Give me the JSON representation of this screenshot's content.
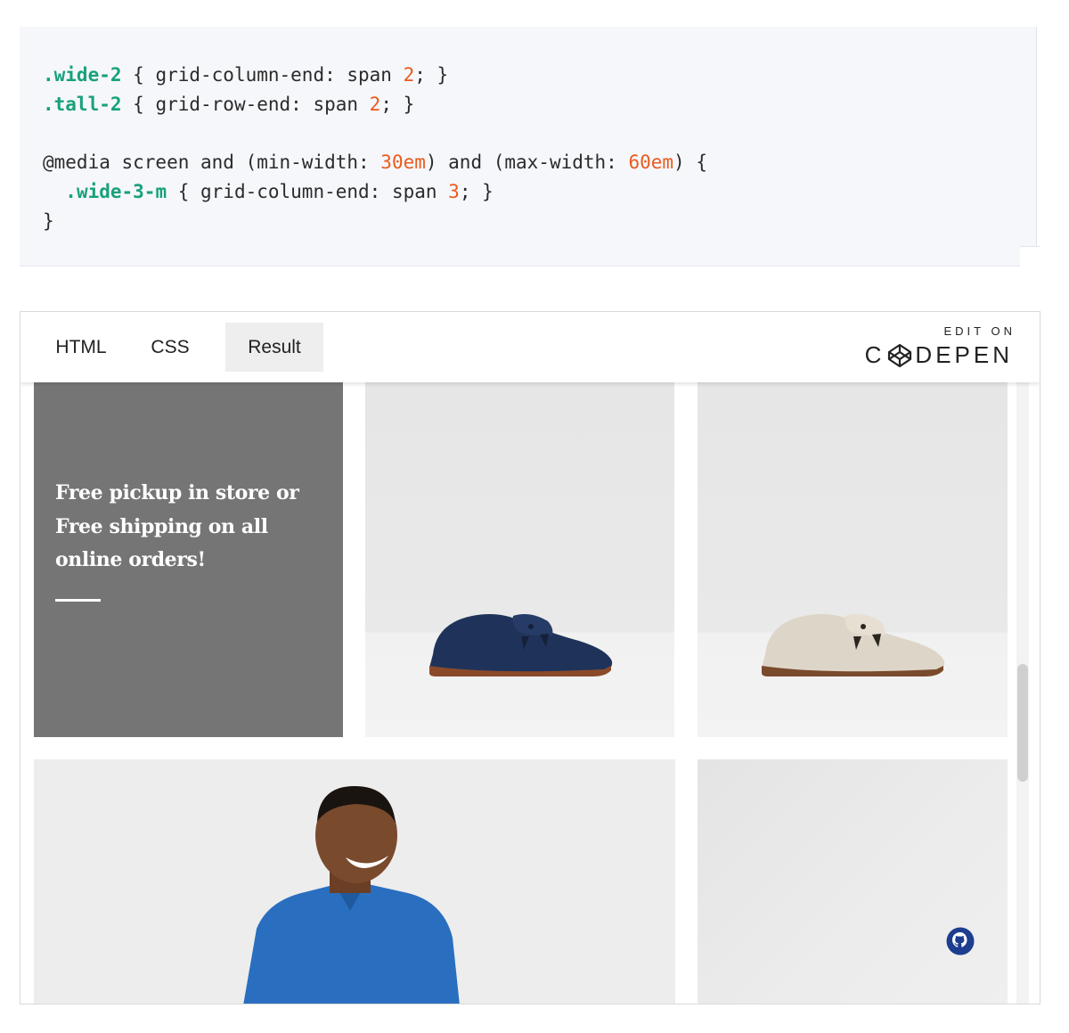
{
  "code": {
    "line1": {
      "selector": ".wide-2",
      "open": " { grid-column-end: span ",
      "value": "2",
      "close": "; }"
    },
    "line2": {
      "selector": ".tall-2",
      "open": " { grid-row-end: span ",
      "value": "2",
      "close": "; }"
    },
    "line3": {
      "prefix": "@media screen and (min-width: ",
      "min": "30em",
      "middle": ") and (max-width: ",
      "max": "60em",
      "suffix": ") {"
    },
    "line4": {
      "indent": "  ",
      "selector": ".wide-3-m",
      "open": " { grid-column-end: span ",
      "value": "3",
      "close": "; }"
    },
    "line5": "}",
    "colors": {
      "selector": "#17a17c",
      "number": "#ea5a1e",
      "background": "#f6f7fb"
    }
  },
  "embed": {
    "tabs": [
      {
        "label": "HTML",
        "active": false
      },
      {
        "label": "CSS",
        "active": false
      },
      {
        "label": "Result",
        "active": true
      }
    ],
    "edit_on": "EDIT ON",
    "codepen_c": "C",
    "codepen_rest": "DEPEN",
    "promo": {
      "text": "Free pickup in store or Free shipping on all online orders!",
      "background": "#757575"
    },
    "tiles": [
      {
        "name": "navy-suede-loafer",
        "shoe_color": "#1f335a"
      },
      {
        "name": "beige-suede-loafer",
        "shoe_color": "#ddd6c8"
      },
      {
        "name": "man-in-denim-shirt",
        "shirt_color": "#2a6fbf"
      },
      {
        "name": "light-grey-tile"
      }
    ],
    "icons": {
      "github": "github-icon",
      "codepen": "codepen-logo-icon"
    }
  }
}
